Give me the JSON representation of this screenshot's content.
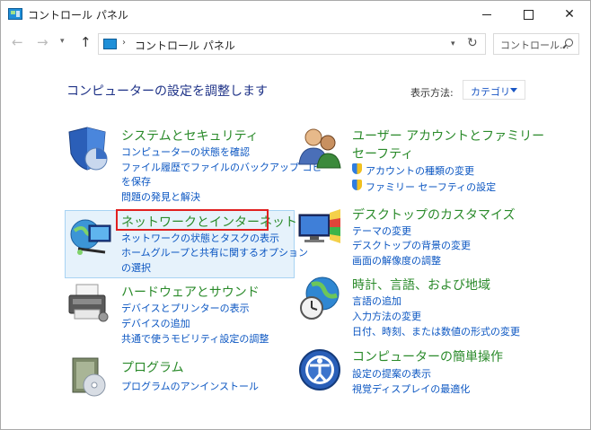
{
  "window": {
    "title": "コントロール パネル"
  },
  "address_bar": {
    "path": "コントロール パネル",
    "separator": "›",
    "search_placeholder": "コントロール..."
  },
  "header": {
    "title": "コンピューターの設定を調整します",
    "view_label": "表示方法:",
    "view_value": "カテゴリ"
  },
  "categories": {
    "system": {
      "title": "システムとセキュリティ",
      "links": [
        "コンピューターの状態を確認",
        "ファイル履歴でファイルのバックアップ コピー",
        "を保存",
        "問題の発見と解決"
      ]
    },
    "network": {
      "title": "ネットワークとインターネット",
      "links": [
        "ネットワークの状態とタスクの表示",
        "ホームグループと共有に関するオプション",
        "の選択"
      ]
    },
    "hardware": {
      "title": "ハードウェアとサウンド",
      "links": [
        "デバイスとプリンターの表示",
        "デバイスの追加",
        "共通で使うモビリティ設定の調整"
      ]
    },
    "programs": {
      "title": "プログラム",
      "links": [
        "プログラムのアンインストール"
      ]
    },
    "users": {
      "title_line1": "ユーザー アカウントとファミリー",
      "title_line2": "セーフティ",
      "links": [
        "アカウントの種類の変更",
        "ファミリー セーフティの設定"
      ]
    },
    "appearance": {
      "title": "デスクトップのカスタマイズ",
      "links": [
        "テーマの変更",
        "デスクトップの背景の変更",
        "画面の解像度の調整"
      ]
    },
    "clock": {
      "title": "時計、言語、および地域",
      "links": [
        "言語の追加",
        "入力方法の変更",
        "日付、時刻、または数値の形式の変更"
      ]
    },
    "ease": {
      "title": "コンピューターの簡単操作",
      "links": [
        "設定の提案の表示",
        "視覚ディスプレイの最適化"
      ]
    }
  }
}
